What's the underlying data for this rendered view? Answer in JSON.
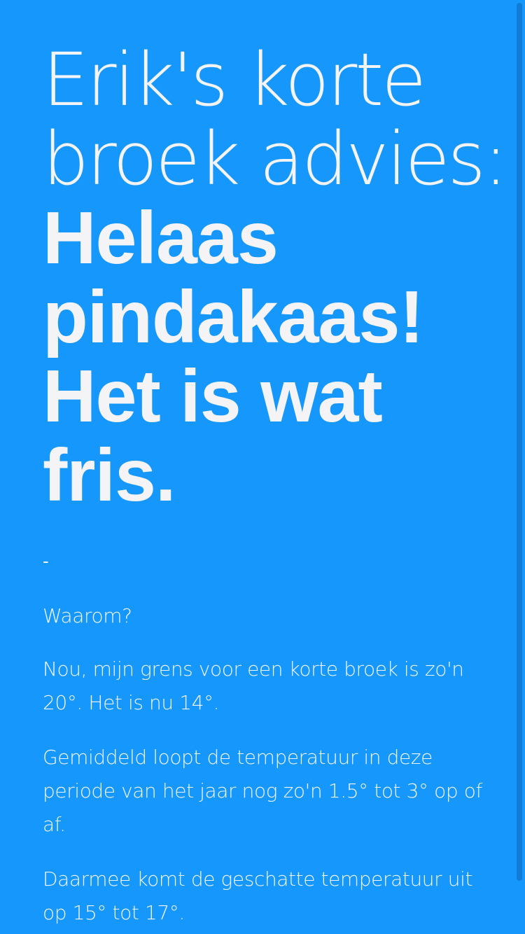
{
  "heading": {
    "light_lines": [
      "Erik's korte",
      "broek advies:"
    ],
    "bold_lines": [
      "Helaas",
      "pindakaas!",
      "Het is wat",
      "fris."
    ]
  },
  "separator": "-",
  "why_label": "Waarom?",
  "paragraphs": [
    "Nou, mijn grens voor een korte broek is zo'n 20°. Het is nu 14°.",
    "Gemiddeld loopt de temperatuur in deze periode van het jaar nog zo'n 1.5° tot 3° op of af.",
    "Daarmee komt de geschatte temperatuur uit op 15° tot 17°."
  ],
  "colors": {
    "background": "#1697fb",
    "text": "#f4f4f7"
  }
}
